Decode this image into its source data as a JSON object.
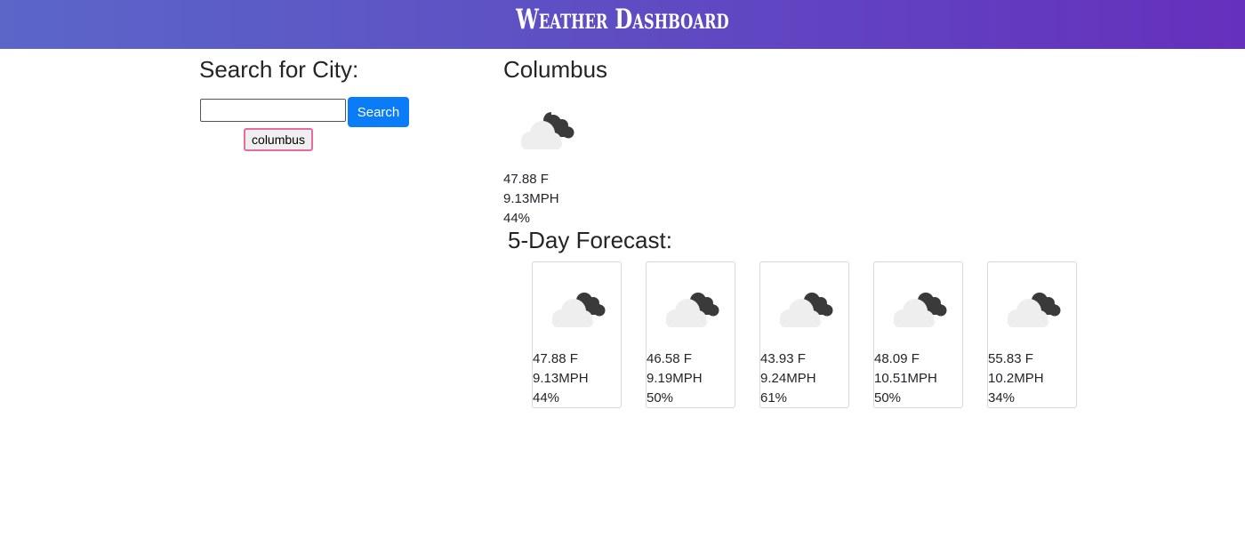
{
  "header": {
    "title": "Weather Dashboard"
  },
  "search": {
    "heading": "Search for City:",
    "input_value": "",
    "placeholder": "",
    "button_label": "Search",
    "history": [
      "columbus"
    ]
  },
  "current": {
    "city": "Columbus",
    "icon": "cloudy-night-icon",
    "temp": "47.88 F",
    "wind": "9.13MPH",
    "humidity": "44%"
  },
  "forecast": {
    "heading": "5-Day Forecast:",
    "days": [
      {
        "icon": "cloudy-night-icon",
        "temp": "47.88 F",
        "wind": "9.13MPH",
        "humidity": "44%"
      },
      {
        "icon": "cloudy-night-icon",
        "temp": "46.58 F",
        "wind": "9.19MPH",
        "humidity": "50%"
      },
      {
        "icon": "cloudy-night-icon",
        "temp": "43.93 F",
        "wind": "9.24MPH",
        "humidity": "61%"
      },
      {
        "icon": "cloudy-night-icon",
        "temp": "48.09 F",
        "wind": "10.51MPH",
        "humidity": "50%"
      },
      {
        "icon": "cloudy-night-icon",
        "temp": "55.83 F",
        "wind": "10.2MPH",
        "humidity": "34%"
      }
    ]
  },
  "colors": {
    "header_gradient_start": "#5b66c9",
    "header_gradient_end": "#6530bd",
    "search_button": "#0a7cf7",
    "history_border": "#e76aa0",
    "cloud": "#eeeeee",
    "moon_cloud": "#3a3a3a"
  }
}
